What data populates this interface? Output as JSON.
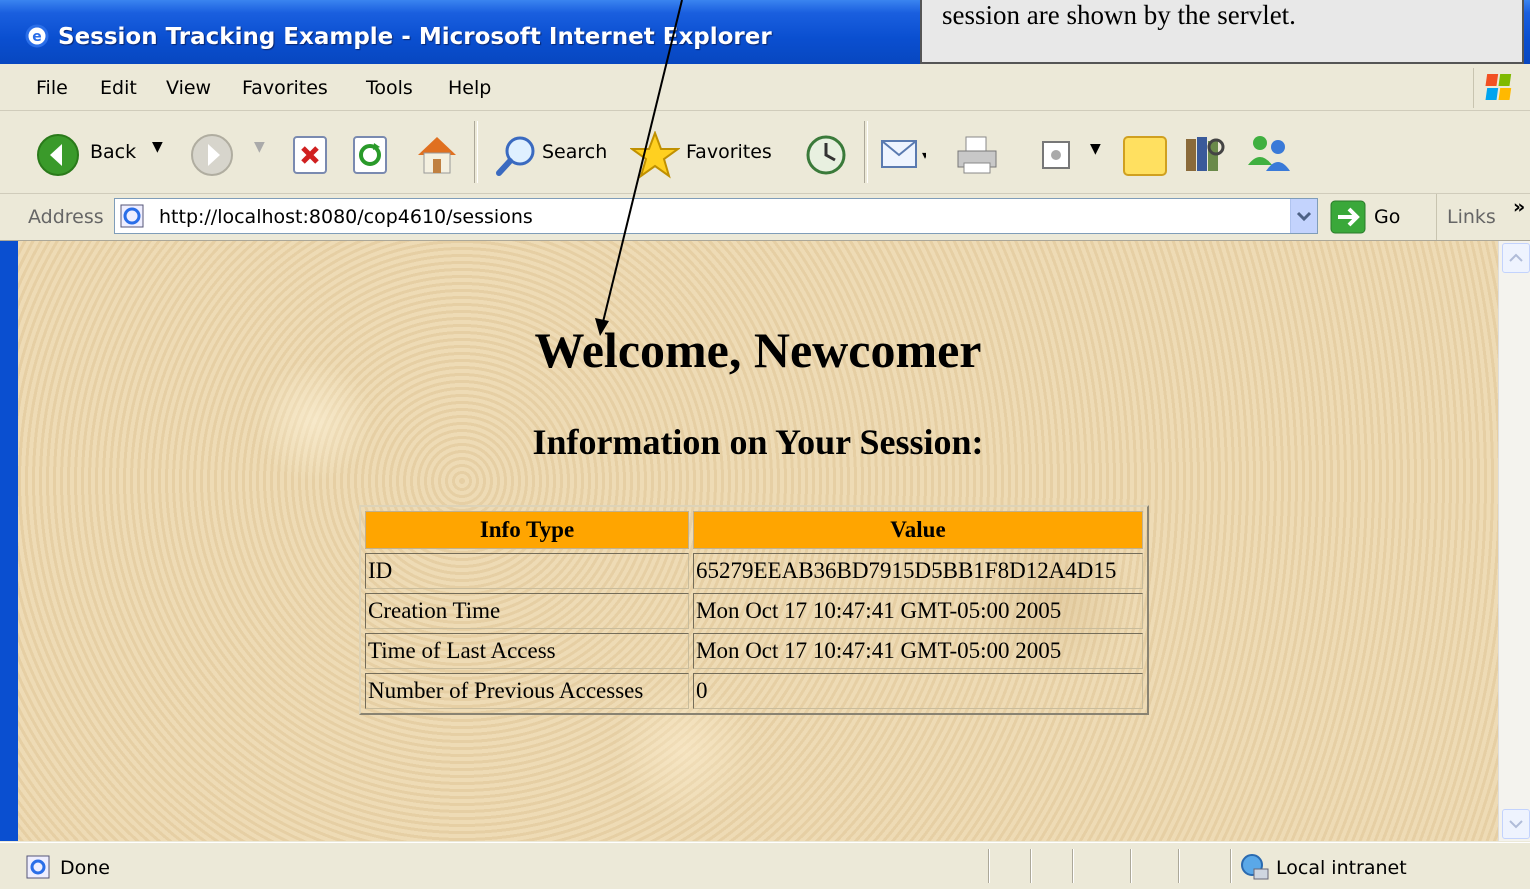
{
  "window": {
    "title": "Session Tracking Example - Microsoft Internet Explorer"
  },
  "annotation": {
    "text": "session are shown by the servlet."
  },
  "menu": {
    "items": [
      "File",
      "Edit",
      "View",
      "Favorites",
      "Tools",
      "Help"
    ]
  },
  "toolbar": {
    "back_label": "Back",
    "search_label": "Search",
    "favorites_label": "Favorites"
  },
  "address": {
    "label": "Address",
    "url": "http://localhost:8080/cop4610/sessions",
    "go_label": "Go",
    "links_label": "Links"
  },
  "page": {
    "heading": "Welcome, Newcomer",
    "subheading": "Information on Your Session:",
    "table": {
      "headers": [
        "Info Type",
        "Value"
      ],
      "rows": [
        [
          "ID",
          "65279EEAB36BD7915D5BB1F8D12A4D15"
        ],
        [
          "Creation Time",
          "Mon Oct 17 10:47:41 GMT-05:00 2005"
        ],
        [
          "Time of Last Access",
          "Mon Oct 17 10:47:41 GMT-05:00 2005"
        ],
        [
          "Number of Previous Accesses",
          "0"
        ]
      ],
      "header_color": "#ffa500"
    }
  },
  "status": {
    "text": "Done",
    "zone": "Local intranet"
  },
  "colors": {
    "titlebar": "#0a4fd0",
    "chrome": "#ece9d8",
    "page_bg": "#ecd7ae"
  },
  "icons": [
    "ie-icon",
    "back-icon",
    "forward-icon",
    "stop-icon",
    "refresh-icon",
    "home-icon",
    "search-icon",
    "favorites-icon",
    "history-icon",
    "mail-icon",
    "print-icon",
    "edit-icon",
    "notes-icon",
    "research-icon",
    "messenger-icon",
    "go-icon",
    "local-intranet-icon"
  ]
}
